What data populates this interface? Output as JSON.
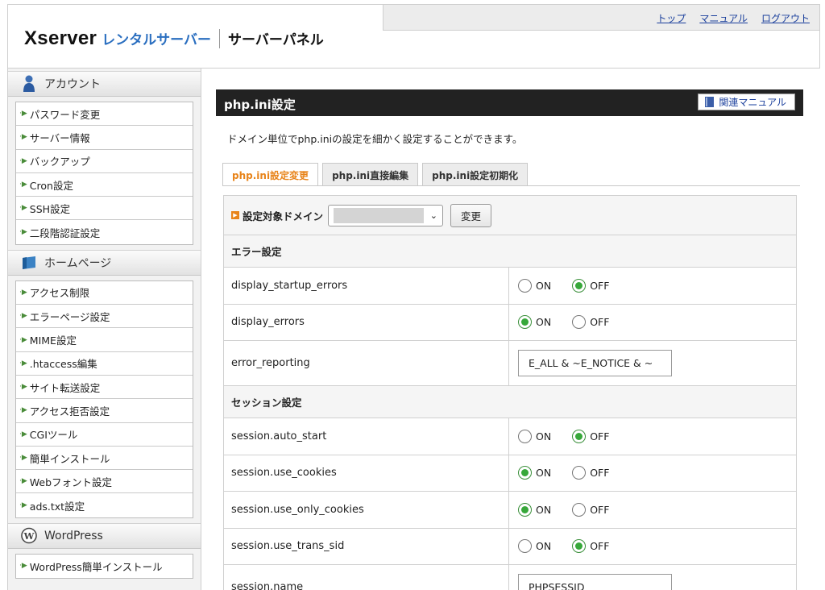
{
  "header": {
    "logo": {
      "brand": "Xserver",
      "product": "レンタルサーバー",
      "panel": "サーバーパネル"
    },
    "links": [
      "トップ",
      "マニュアル",
      "ログアウト"
    ]
  },
  "sidebar": {
    "sections": [
      {
        "title": "アカウント",
        "icon": "user-icon",
        "items": [
          "パスワード変更",
          "サーバー情報",
          "バックアップ",
          "Cron設定",
          "SSH設定",
          "二段階認証設定"
        ]
      },
      {
        "title": "ホームページ",
        "icon": "homepage-icon",
        "items": [
          "アクセス制限",
          "エラーページ設定",
          "MIME設定",
          ".htaccess編集",
          "サイト転送設定",
          "アクセス拒否設定",
          "CGIツール",
          "簡単インストール",
          "Webフォント設定",
          "ads.txt設定"
        ]
      },
      {
        "title": "WordPress",
        "icon": "wordpress-icon",
        "items": [
          "WordPress簡単インストール"
        ]
      }
    ]
  },
  "main": {
    "title": "php.ini設定",
    "manual_label": "関連マニュアル",
    "description": "ドメイン単位でphp.iniの設定を細かく設定することができます。",
    "tabs": [
      {
        "label": "php.ini設定変更",
        "active": true
      },
      {
        "label": "php.ini直接編集",
        "active": false
      },
      {
        "label": "php.ini設定初期化",
        "active": false
      }
    ],
    "domain": {
      "label": "設定対象ドメイン",
      "change_label": "変更"
    },
    "on_label": "ON",
    "off_label": "OFF",
    "groups": [
      {
        "title": "エラー設定",
        "rows": [
          {
            "name": "display_startup_errors",
            "type": "radio",
            "value": "OFF"
          },
          {
            "name": "display_errors",
            "type": "radio",
            "value": "ON"
          },
          {
            "name": "error_reporting",
            "type": "text",
            "value": "E_ALL & ~E_NOTICE & ~"
          }
        ]
      },
      {
        "title": "セッション設定",
        "rows": [
          {
            "name": "session.auto_start",
            "type": "radio",
            "value": "OFF"
          },
          {
            "name": "session.use_cookies",
            "type": "radio",
            "value": "ON"
          },
          {
            "name": "session.use_only_cookies",
            "type": "radio",
            "value": "ON"
          },
          {
            "name": "session.use_trans_sid",
            "type": "radio",
            "value": "OFF"
          },
          {
            "name": "session.name",
            "type": "text",
            "value": "PHPSESSID"
          }
        ]
      }
    ]
  },
  "colors": {
    "accent": "#e8841a",
    "link": "#1a3f9c",
    "radio_on": "#37a83a",
    "title_bar": "#222222"
  }
}
